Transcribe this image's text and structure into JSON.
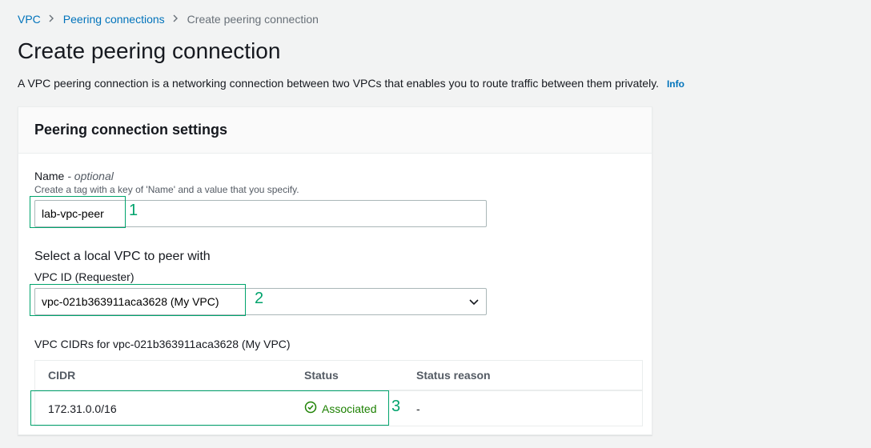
{
  "breadcrumb": {
    "vpc": "VPC",
    "peering": "Peering connections",
    "current": "Create peering connection"
  },
  "page": {
    "title": "Create peering connection",
    "subtitle": "A VPC peering connection is a networking connection between two VPCs that enables you to route traffic between them privately.",
    "info": "Info"
  },
  "panel": {
    "title": "Peering connection settings"
  },
  "name_field": {
    "label": "Name",
    "optional": " - optional",
    "hint": "Create a tag with a key of 'Name' and a value that you specify.",
    "value": "lab-vpc-peer"
  },
  "local_vpc": {
    "heading": "Select a local VPC to peer with",
    "id_label": "VPC ID (Requester)",
    "selected": "vpc-021b363911aca3628 (My VPC)"
  },
  "cidrs": {
    "label": "VPC CIDRs for vpc-021b363911aca3628 (My VPC)",
    "headers": {
      "cidr": "CIDR",
      "status": "Status",
      "reason": "Status reason"
    },
    "row": {
      "cidr": "172.31.0.0/16",
      "status": "Associated",
      "reason": "-"
    }
  },
  "annotations": {
    "a1": "1",
    "a2": "2",
    "a3": "3"
  }
}
